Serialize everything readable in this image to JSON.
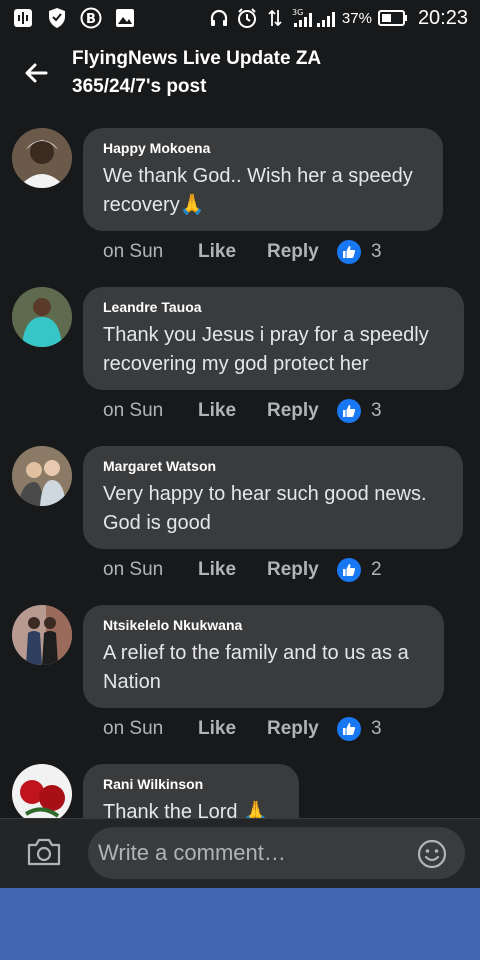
{
  "status_bar": {
    "network": "3G",
    "battery": "37%",
    "time": "20:23"
  },
  "header": {
    "title_line1": "FlyingNews Live Update ZA",
    "title_line2": "365/24/7's post"
  },
  "comments": [
    {
      "author": "Happy Mokoena",
      "text": "We thank God.. Wish her a speedy recovery🙏",
      "time": "on Sun",
      "like_label": "Like",
      "reply_label": "Reply",
      "reactions": "3"
    },
    {
      "author": "Leandre Tauoa",
      "text": "Thank you Jesus i pray for a speedly recovering my god protect her",
      "time": "on Sun",
      "like_label": "Like",
      "reply_label": "Reply",
      "reactions": "3"
    },
    {
      "author": "Margaret Watson",
      "text": "Very happy to hear such good news. God is good",
      "time": "on Sun",
      "like_label": "Like",
      "reply_label": "Reply",
      "reactions": "2"
    },
    {
      "author": "Ntsikelelo Nkukwana",
      "text": "A relief to the family and to us as a Nation",
      "time": "on Sun",
      "like_label": "Like",
      "reply_label": "Reply",
      "reactions": "3"
    },
    {
      "author": "Rani Wilkinson",
      "text": "Thank the Lord 🙏"
    }
  ],
  "composer": {
    "placeholder": "Write a comment…"
  },
  "icons": {
    "back": "arrow-left-icon",
    "camera": "camera-icon",
    "emoji": "smiley-icon",
    "like": "thumbs-up-icon"
  },
  "colors": {
    "background": "#18191a",
    "bubble": "#3a3b3c",
    "like_blue": "#1877f2",
    "nav_bar": "#4267b2"
  }
}
